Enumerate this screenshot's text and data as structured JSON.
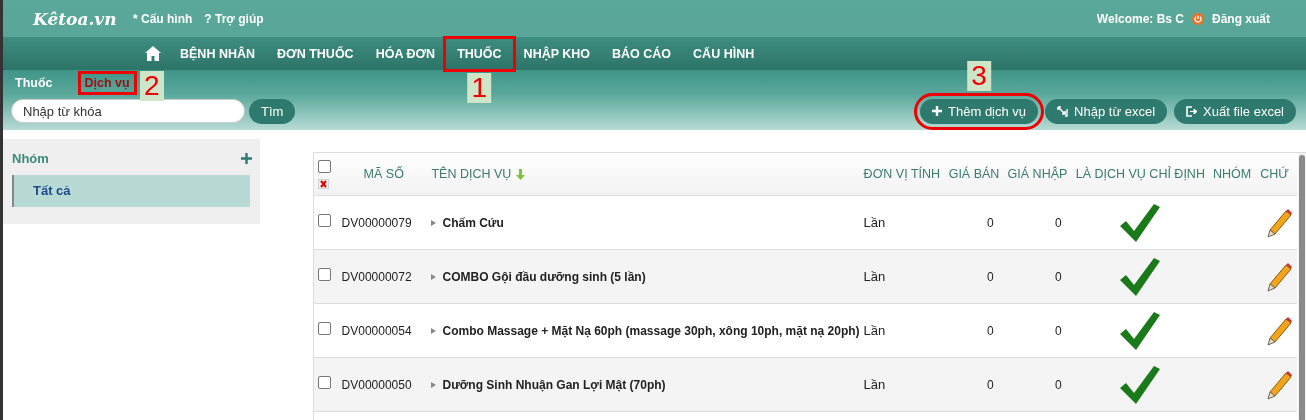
{
  "header": {
    "logo": "Kêtoa.vn",
    "links": [
      {
        "icon": "*",
        "label": "Cấu hình"
      },
      {
        "icon": "?",
        "label": "Trợ giúp"
      }
    ],
    "welcome": "Welcome: Bs C",
    "logout": "Đăng xuất"
  },
  "nav": [
    {
      "label": "BỆNH NHÂN"
    },
    {
      "label": "ĐƠN THUỐC"
    },
    {
      "label": "HÓA ĐƠN"
    },
    {
      "label": "THUỐC",
      "callout": "1"
    },
    {
      "label": "NHẬP KHO"
    },
    {
      "label": "BÁO CÁO"
    },
    {
      "label": "CẤU HÌNH"
    }
  ],
  "tabs": [
    {
      "label": "Thuốc",
      "selected": false
    },
    {
      "label": "Dịch vụ",
      "selected": true,
      "callout": "2"
    }
  ],
  "search": {
    "placeholder": "Nhập từ khóa",
    "button": "Tìm"
  },
  "actions": [
    {
      "kind": "add",
      "label": "Thêm dịch vụ",
      "callout": "3"
    },
    {
      "kind": "import",
      "label": "Nhập từ excel"
    },
    {
      "kind": "export",
      "label": "Xuất file excel"
    }
  ],
  "groups": {
    "title": "Nhóm",
    "items": [
      {
        "label": "Tất cả",
        "selected": true
      }
    ]
  },
  "table": {
    "all_checked": false,
    "columns": [
      "MÃ SỐ",
      "TÊN DỊCH VỤ",
      "ĐƠN VỊ TÍNH",
      "GIÁ BÁN",
      "GIÁ NHẬP",
      "LÀ DỊCH VỤ CHỈ ĐỊNH",
      "NHÓM",
      "CHỨ"
    ],
    "rows": [
      {
        "checked": false,
        "code": "DV00000079",
        "name": "Chấm Cứu",
        "unit": "Lần",
        "price": "0",
        "cost": "0",
        "designated": true
      },
      {
        "checked": false,
        "code": "DV00000072",
        "name": "COMBO Gội đầu dưỡng sinh (5 lần)",
        "unit": "Lần",
        "price": "0",
        "cost": "0",
        "designated": true
      },
      {
        "checked": false,
        "code": "DV00000054",
        "name": "Combo Massage + Mặt Nạ 60ph (massage 30ph, xông 10ph, mặt nạ 20ph)",
        "unit": "Lần",
        "price": "0",
        "cost": "0",
        "designated": true
      },
      {
        "checked": false,
        "code": "DV00000050",
        "name": "Dưỡng Sinh Nhuận Gan Lợi Mật (70ph)",
        "unit": "Lần",
        "price": "0",
        "cost": "0",
        "designated": true
      }
    ]
  }
}
